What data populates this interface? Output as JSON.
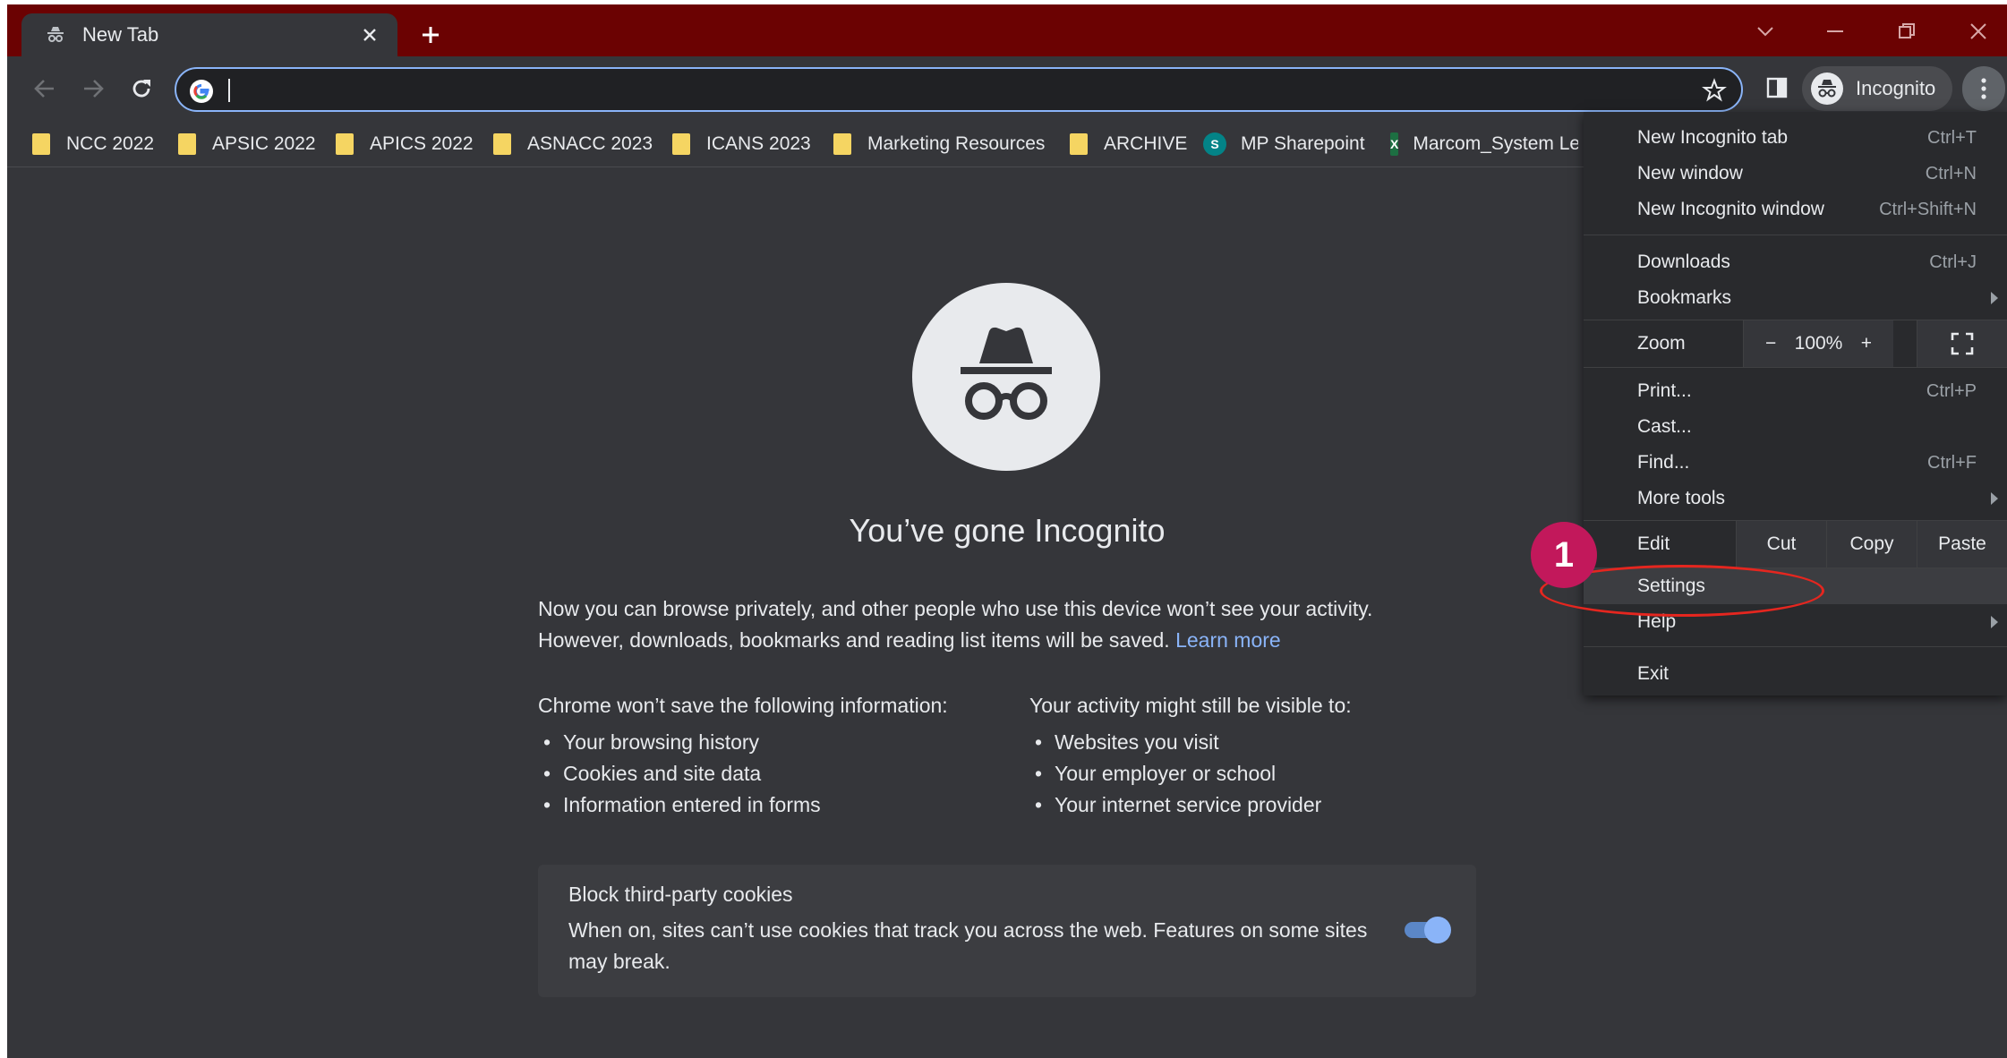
{
  "tab": {
    "title": "New Tab"
  },
  "toolbar": {
    "profile_label": "Incognito"
  },
  "bookmarks": [
    {
      "label": "NCC 2022",
      "type": "folder"
    },
    {
      "label": "APSIC 2022",
      "type": "folder"
    },
    {
      "label": "APICS 2022",
      "type": "folder"
    },
    {
      "label": "ASNACC 2023",
      "type": "folder"
    },
    {
      "label": "ICANS 2023",
      "type": "folder"
    },
    {
      "label": "Marketing Resources",
      "type": "folder"
    },
    {
      "label": "ARCHIVE",
      "type": "folder"
    },
    {
      "label": "MP Sharepoint",
      "type": "sharepoint",
      "icon": "S"
    },
    {
      "label": "Marcom_System Le",
      "type": "excel",
      "icon": "X"
    }
  ],
  "main": {
    "headline": "You’ve gone Incognito",
    "intro_line1": "Now you can browse privately, and other people who use this device won’t see your activity.",
    "intro_line2": "However, downloads, bookmarks and reading list items will be saved.",
    "learn_more": "Learn more",
    "left_col": {
      "title": "Chrome won’t save the following information:",
      "items": [
        "Your browsing history",
        "Cookies and site data",
        "Information entered in forms"
      ]
    },
    "right_col": {
      "title": "Your activity might still be visible to:",
      "items": [
        "Websites you visit",
        "Your employer or school",
        "Your internet service provider"
      ]
    },
    "cookies": {
      "title": "Block third-party cookies",
      "description": "When on, sites can’t use cookies that track you across the web. Features on some sites may break.",
      "enabled": true
    }
  },
  "menu": {
    "new_incognito_tab": {
      "label": "New Incognito tab",
      "shortcut": "Ctrl+T"
    },
    "new_window": {
      "label": "New window",
      "shortcut": "Ctrl+N"
    },
    "new_incognito_window": {
      "label": "New Incognito window",
      "shortcut": "Ctrl+Shift+N"
    },
    "downloads": {
      "label": "Downloads",
      "shortcut": "Ctrl+J"
    },
    "bookmarks": {
      "label": "Bookmarks"
    },
    "zoom": {
      "label": "Zoom",
      "minus": "−",
      "value": "100%",
      "plus": "+"
    },
    "print": {
      "label": "Print...",
      "shortcut": "Ctrl+P"
    },
    "cast": {
      "label": "Cast..."
    },
    "find": {
      "label": "Find...",
      "shortcut": "Ctrl+F"
    },
    "more_tools": {
      "label": "More tools"
    },
    "edit": {
      "label": "Edit",
      "cut": "Cut",
      "copy": "Copy",
      "paste": "Paste"
    },
    "settings": {
      "label": "Settings"
    },
    "help": {
      "label": "Help"
    },
    "exit": {
      "label": "Exit"
    }
  },
  "annotation": {
    "step": "1"
  },
  "colors": {
    "tabstrip": "#6b0202",
    "background": "#35363a",
    "menu": "#292a2d",
    "link": "#8ab4f8",
    "annotation_badge": "#c2185b",
    "annotation_ring": "#e5261f"
  }
}
